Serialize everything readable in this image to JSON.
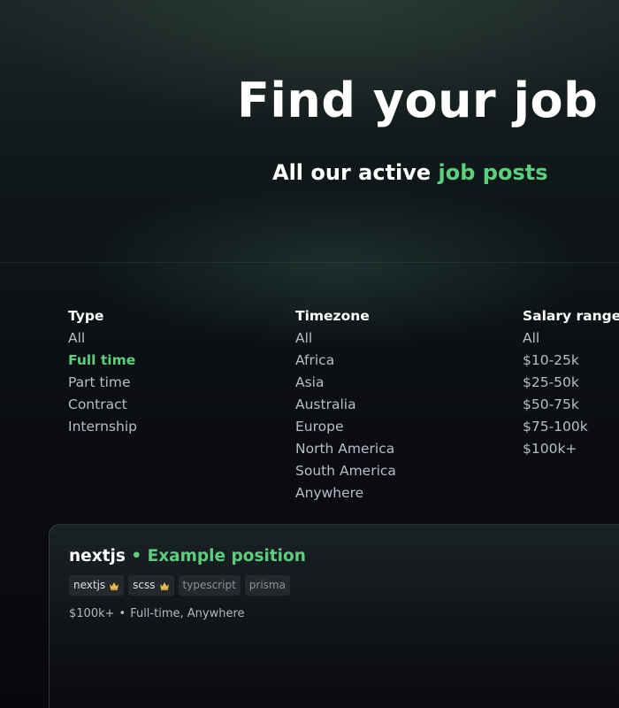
{
  "hero": {
    "title": "Find your job",
    "subtitle_prefix": "All our active ",
    "subtitle_accent": "job posts"
  },
  "filters": {
    "type": {
      "heading": "Type",
      "options": [
        "All",
        "Full time",
        "Part time",
        "Contract",
        "Internship"
      ],
      "selected": "Full time"
    },
    "timezone": {
      "heading": "Timezone",
      "options": [
        "All",
        "Africa",
        "Asia",
        "Australia",
        "Europe",
        "North America",
        "South America",
        "Anywhere"
      ]
    },
    "salary": {
      "heading": "Salary range",
      "options": [
        "All",
        "$10-25k",
        "$25-50k",
        "$50-75k",
        "$75-100k",
        "$100k+"
      ]
    }
  },
  "job": {
    "company": "nextjs",
    "separator": "•",
    "position": "Example position",
    "tags": [
      {
        "label": "nextjs",
        "featured": true,
        "icon": "crown-icon"
      },
      {
        "label": "scss",
        "featured": true,
        "icon": "crown-icon"
      },
      {
        "label": "typescript",
        "featured": false
      },
      {
        "label": "prisma",
        "featured": false
      }
    ],
    "salary": "$100k+",
    "meta_separator": "•",
    "details": "Full-time, Anywhere"
  },
  "colors": {
    "accent": "#5ccf7d",
    "heading": "#ffffff",
    "muted": "#b8bec8",
    "crown": "#e9b949"
  }
}
